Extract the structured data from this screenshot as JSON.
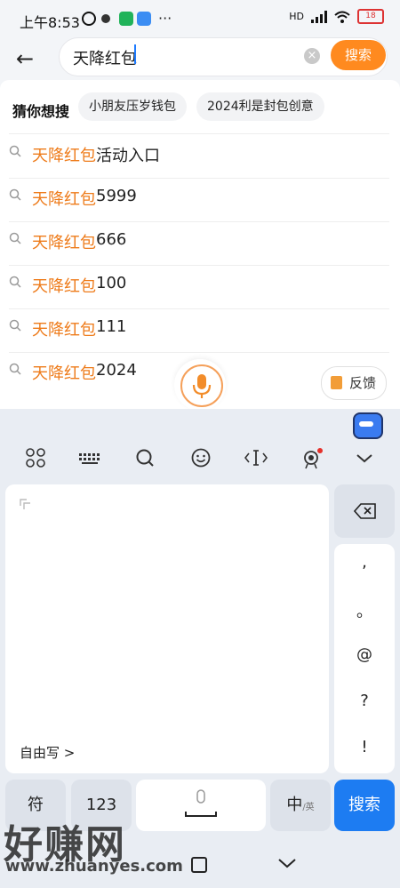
{
  "status_bar": {
    "time": "上午8:53",
    "signal": "HD",
    "battery": "18",
    "more": "···"
  },
  "search": {
    "query": "天降红包",
    "button_label": "搜索",
    "clear": "×",
    "back": "←"
  },
  "guess": {
    "label": "猜你想搜",
    "chips": [
      "小朋友压岁钱包",
      "2024利是封包创意"
    ]
  },
  "suggestions": [
    {
      "highlight": "天降红包",
      "rest": "活动入口"
    },
    {
      "highlight": "天降红包",
      "rest": "5999"
    },
    {
      "highlight": "天降红包",
      "rest": "666"
    },
    {
      "highlight": "天降红包",
      "rest": "100"
    },
    {
      "highlight": "天降红包",
      "rest": "111"
    },
    {
      "highlight": "天降红包",
      "rest": "2024"
    }
  ],
  "feedback_label": "反馈",
  "keyboard": {
    "free_write": "自由写 >",
    "punct": [
      ",",
      "。",
      "@",
      "?",
      "!"
    ],
    "bottom": {
      "symbols": "符",
      "numbers": "123",
      "lang_main": "中",
      "lang_sub": "/英",
      "search": "搜索"
    }
  },
  "watermark": {
    "title": "好赚网",
    "url": "www.zhuanyes.com"
  },
  "colors": {
    "accent_orange": "#ff8a1f",
    "highlight_text": "#ee7b1a",
    "keyboard_blue": "#1d7cf2"
  }
}
